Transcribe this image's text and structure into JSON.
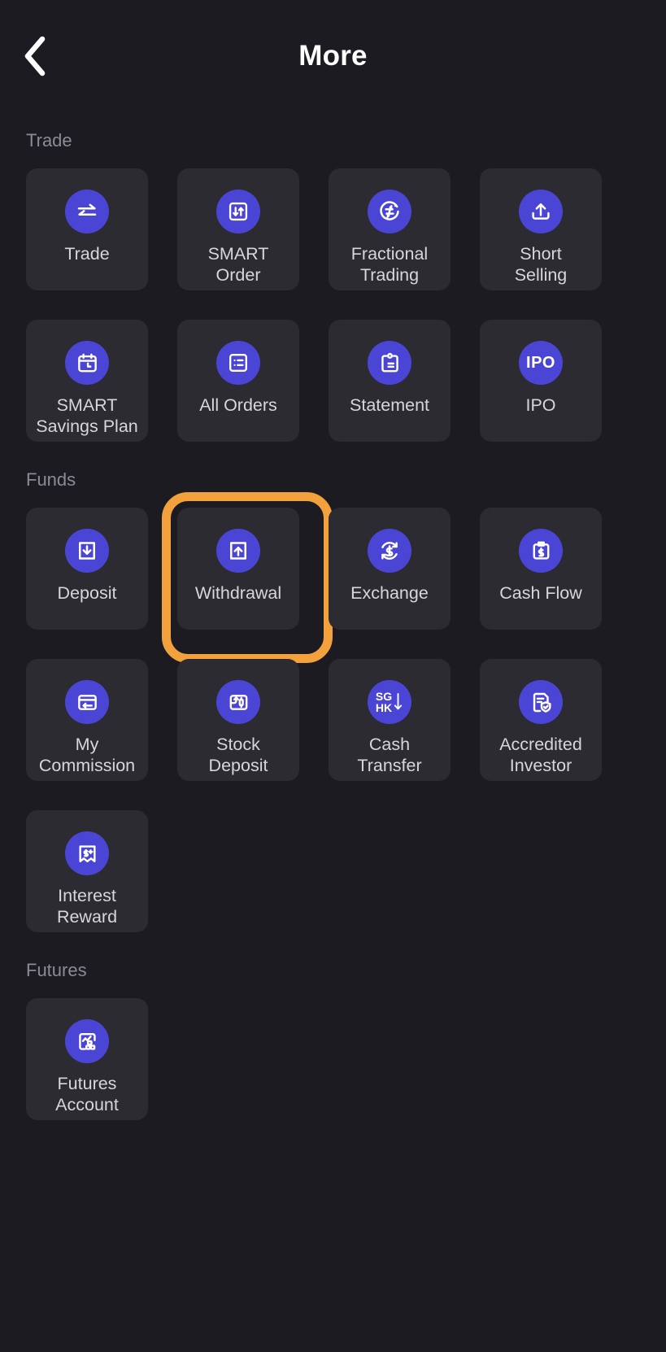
{
  "header": {
    "title": "More",
    "back_icon": "chevron-left-icon"
  },
  "sections": [
    {
      "id": "trade",
      "title": "Trade",
      "items": [
        {
          "label": "Trade",
          "icon": "transfer-arrows-icon",
          "highlighted": false
        },
        {
          "label": "SMART\nOrder",
          "icon": "smart-order-icon",
          "highlighted": false
        },
        {
          "label": "Fractional\nTrading",
          "icon": "fractional-circle-icon",
          "highlighted": false
        },
        {
          "label": "Short\nSelling",
          "icon": "upload-tray-icon",
          "highlighted": false
        },
        {
          "label": "SMART\nSavings Plan",
          "icon": "calendar-clock-icon",
          "highlighted": false
        },
        {
          "label": "All Orders",
          "icon": "list-icon",
          "highlighted": false
        },
        {
          "label": "Statement",
          "icon": "clipboard-icon",
          "highlighted": false
        },
        {
          "label": "IPO",
          "icon": "ipo-text-icon",
          "highlighted": false
        }
      ]
    },
    {
      "id": "funds",
      "title": "Funds",
      "items": [
        {
          "label": "Deposit",
          "icon": "download-box-icon",
          "highlighted": false
        },
        {
          "label": "Withdrawal",
          "icon": "upload-box-icon",
          "highlighted": true
        },
        {
          "label": "Exchange",
          "icon": "currency-exchange-icon",
          "highlighted": false
        },
        {
          "label": "Cash Flow",
          "icon": "clipboard-dollar-icon",
          "highlighted": false
        },
        {
          "label": "My\nCommission",
          "icon": "card-return-icon",
          "highlighted": false
        },
        {
          "label": "Stock\nDeposit",
          "icon": "stock-deposit-icon",
          "highlighted": false
        },
        {
          "label": "Cash\nTransfer",
          "icon": "sg-hk-transfer-icon",
          "highlighted": false
        },
        {
          "label": "Accredited\nInvestor",
          "icon": "document-shield-icon",
          "highlighted": false
        },
        {
          "label": "Interest\nReward",
          "icon": "reward-banner-icon",
          "highlighted": false
        }
      ]
    },
    {
      "id": "futures",
      "title": "Futures",
      "items": [
        {
          "label": "Futures\nAccount",
          "icon": "futures-chart-icon",
          "highlighted": false
        }
      ]
    }
  ],
  "colors": {
    "page_background": "#1b1b21",
    "tile_background": "#2b2b31",
    "accent_blue": "#4b45d6",
    "highlight_orange": "#f2a13c",
    "label_text": "#d6d6dc",
    "section_text": "#8b8b96"
  }
}
